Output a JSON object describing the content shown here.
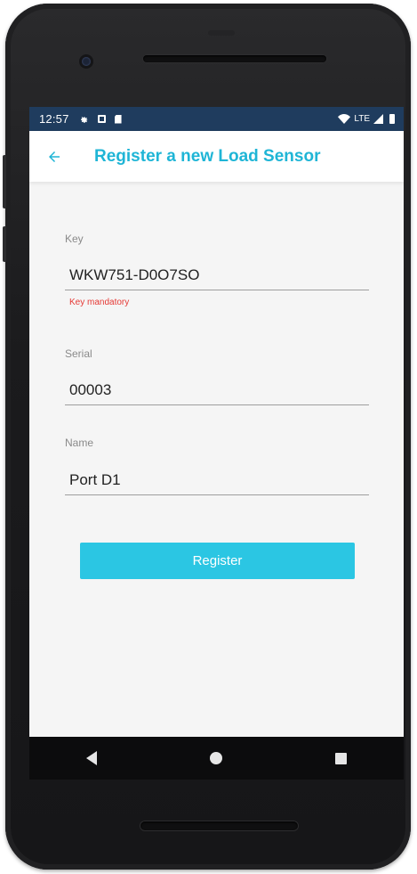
{
  "status_bar": {
    "time": "12:57",
    "network": "LTE",
    "icons": [
      "settings-icon",
      "a-icon",
      "sd-card-icon",
      "wifi-icon",
      "signal-icon",
      "battery-icon"
    ]
  },
  "app_bar": {
    "title": "Register a new Load Sensor",
    "back_icon": "arrow-left-icon",
    "accent_color": "#1fb5d6"
  },
  "form": {
    "key": {
      "label": "Key",
      "value": "WKW751-D0O7SO",
      "error": "Key mandatory"
    },
    "serial": {
      "label": "Serial",
      "value": "00003"
    },
    "name": {
      "label": "Name",
      "value": "Port D1"
    },
    "register_label": "Register",
    "button_color": "#2bc6e3",
    "error_color": "#e53935"
  },
  "nav_bar": {
    "icons": [
      "back-triangle-icon",
      "home-circle-icon",
      "recents-square-icon"
    ]
  }
}
